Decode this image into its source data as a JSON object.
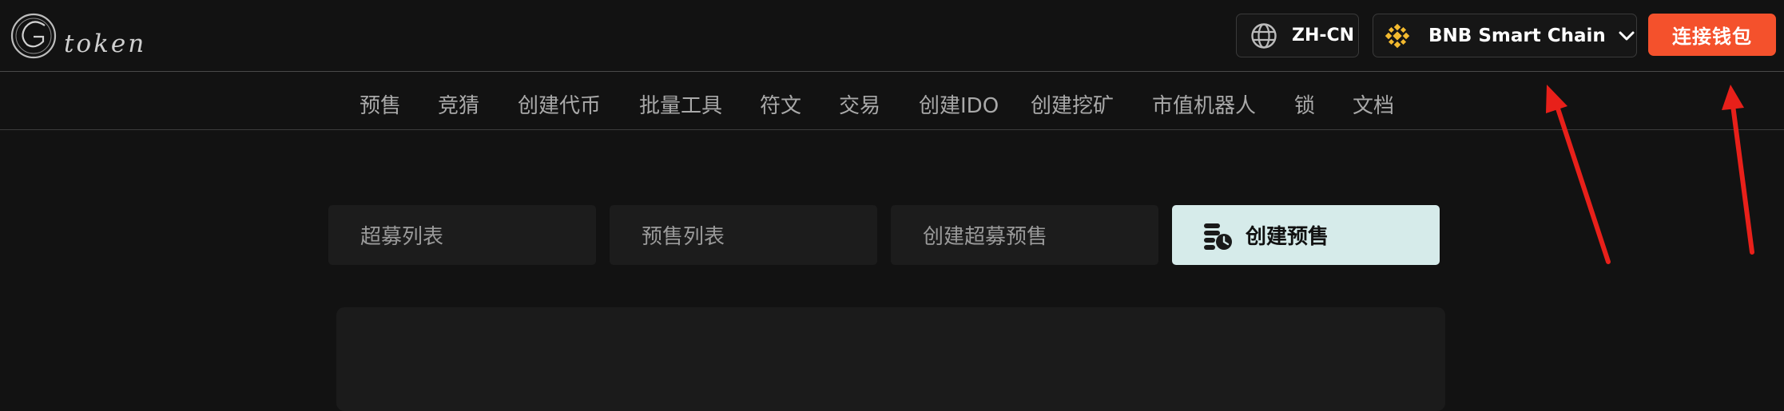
{
  "brand": {
    "logo_text": "token"
  },
  "header": {
    "language_label": "ZH-CN",
    "chain_label": "BNB Smart Chain",
    "connect_label": "连接钱包"
  },
  "nav": {
    "items": [
      "预售",
      "竞猜",
      "创建代币",
      "批量工具",
      "符文",
      "交易",
      "创建IDO",
      "创建挖矿",
      "市值机器人",
      "锁",
      "文档"
    ]
  },
  "tabs": {
    "items": [
      "超募列表",
      "预售列表",
      "创建超募预售",
      "创建预售"
    ],
    "active": "创建预售"
  },
  "colors": {
    "background": "#121212",
    "accent": "#f4512c",
    "active_tab": "#d6ebea",
    "annotation_arrow": "#e8201a"
  },
  "icons": [
    "globe-icon",
    "bnb-logo-icon",
    "chevron-down-icon",
    "presale-create-icon"
  ]
}
